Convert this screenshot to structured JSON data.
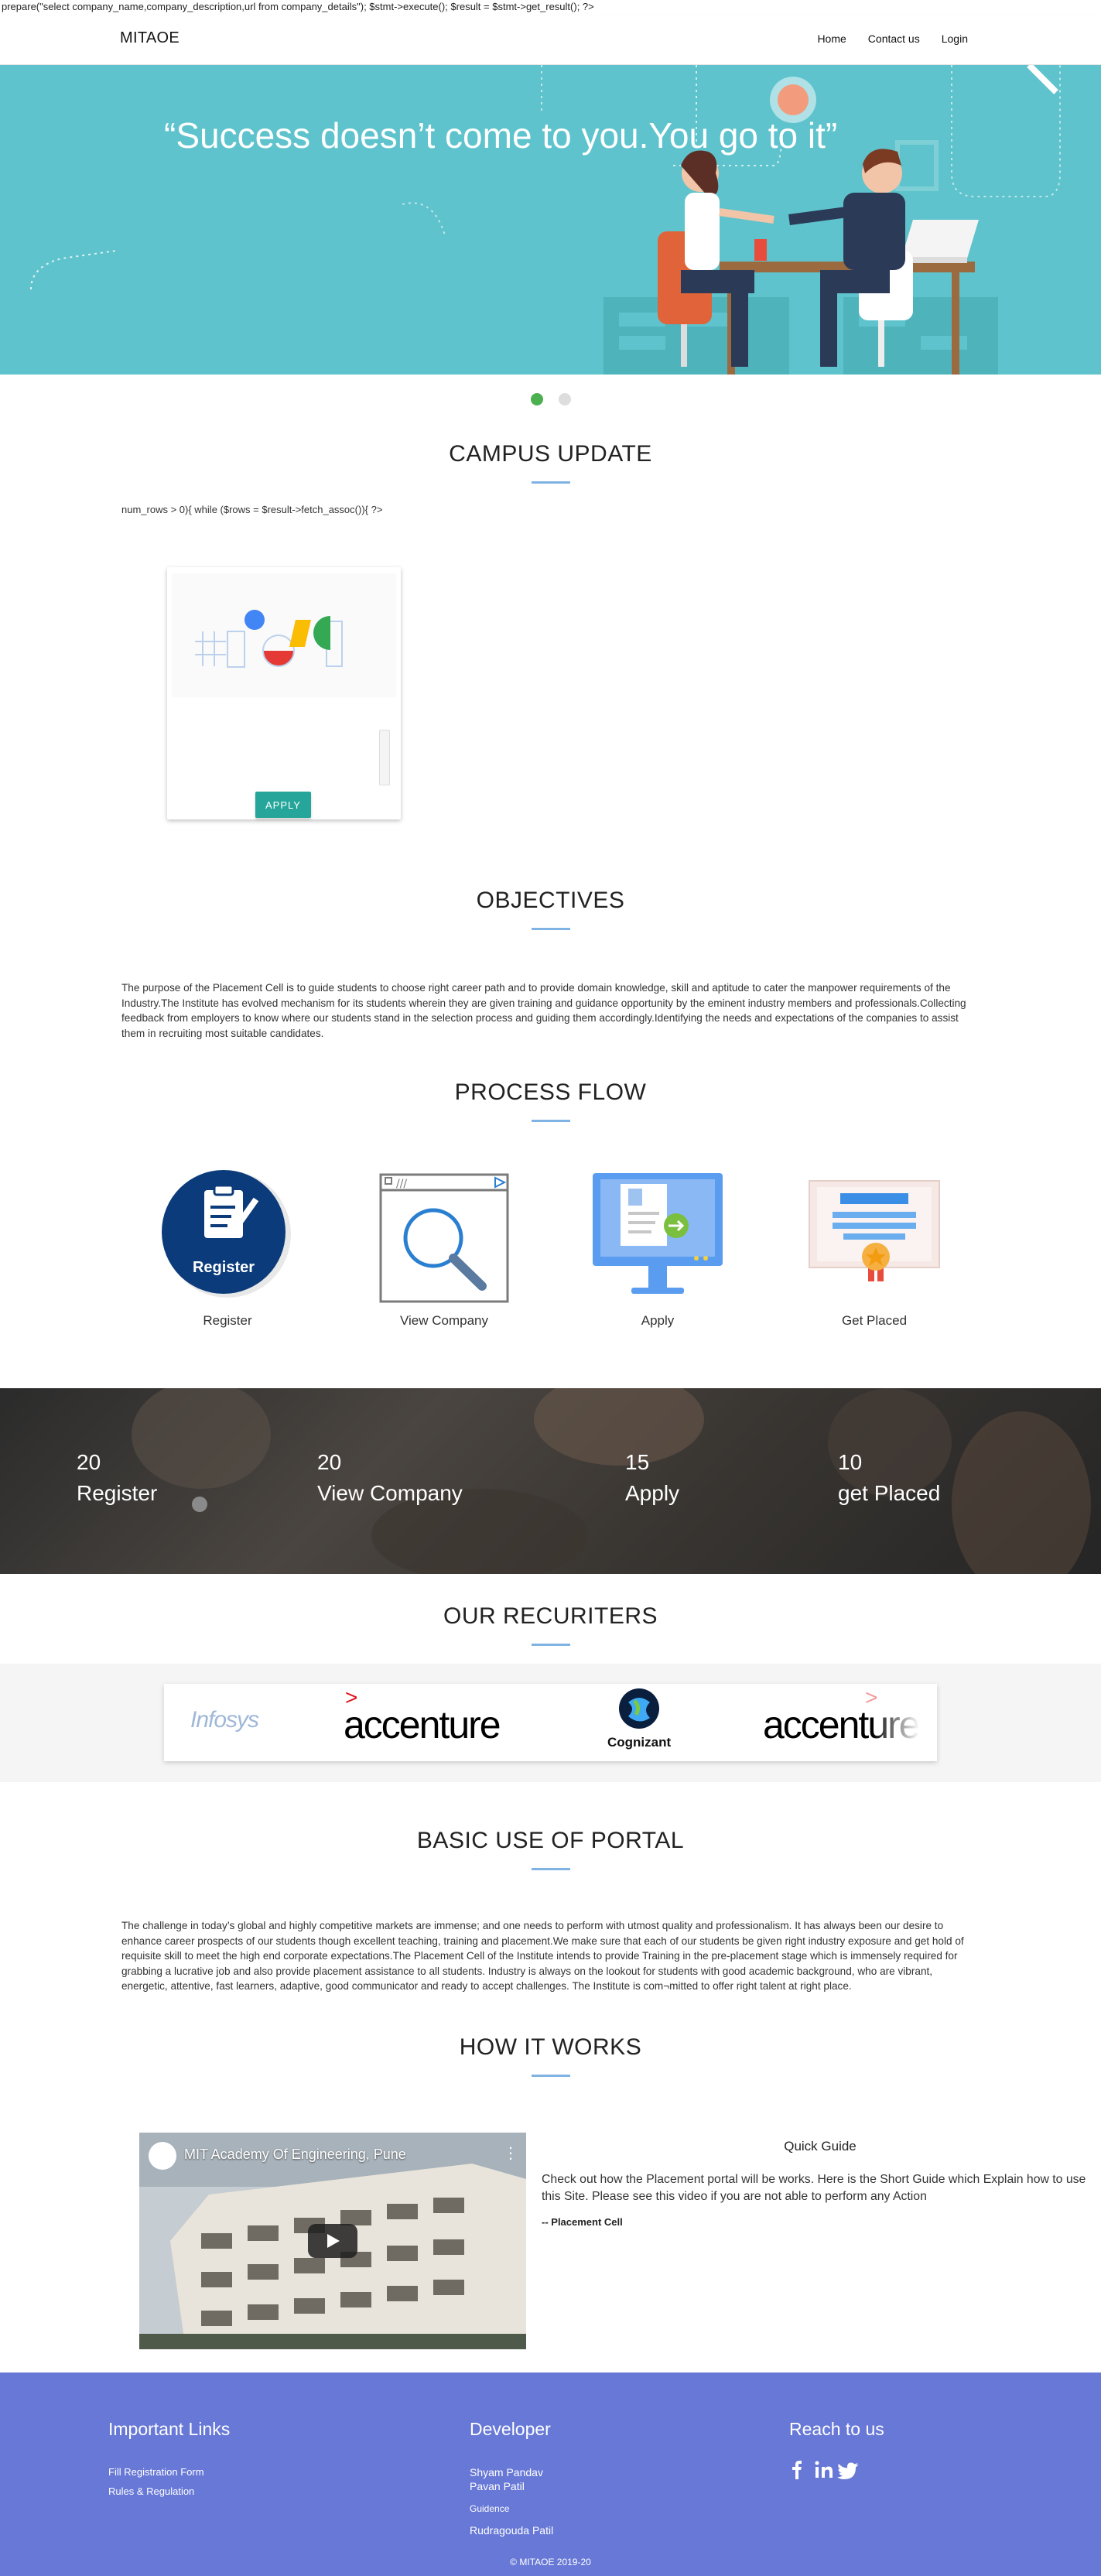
{
  "debug": {
    "php_top": "prepare(\"select company_name,company_description,url from company_details\"); $stmt->execute(); $result = $stmt->get_result(); ?>",
    "php_loop": "num_rows > 0){ while ($rows = $result->fetch_assoc()){ ?>"
  },
  "nav": {
    "brand": "MITAOE",
    "links": [
      "Home",
      "Contact us",
      "Login"
    ]
  },
  "hero": {
    "quote": "“Success doesn’t come to you.You go to it”"
  },
  "sections": {
    "campus_update": "CAMPUS UPDATE",
    "objectives": "OBJECTIVES",
    "process_flow": "PROCESS FLOW",
    "recruiters": "OUR RECURITERS",
    "basic_use": "BASIC USE OF PORTAL",
    "how_it_works": "HOW IT WORKS"
  },
  "campus_card": {
    "apply_label": "APPLY"
  },
  "objectives_text": "The purpose of the Placement Cell is to guide students to choose right career path and to provide domain knowledge, skill and aptitude to cater the manpower requirements of the Industry.The Institute has evolved mechanism for its students wherein they are given training and guidance opportunity by the eminent industry members and professionals.Collecting feedback from employers to know where our students stand in the selection process and guiding them accordingly.Identifying the needs and expectations of the companies to assist them in recruiting most suitable candidates.",
  "process": [
    {
      "label": "Register",
      "icon": "register-badge-icon",
      "icon_text": "Register"
    },
    {
      "label": "View Company",
      "icon": "browser-search-icon"
    },
    {
      "label": "Apply",
      "icon": "monitor-apply-icon"
    },
    {
      "label": "Get Placed",
      "icon": "certificate-icon"
    }
  ],
  "counters": [
    {
      "num": "20",
      "label": "Register"
    },
    {
      "num": "20",
      "label": "View Company"
    },
    {
      "num": "15",
      "label": "Apply"
    },
    {
      "num": "10",
      "label": "get Placed"
    }
  ],
  "recruiters": [
    "Infosys",
    "accenture",
    "Cognizant",
    "accenture"
  ],
  "basic_use_text": "The challenge in today’s global and highly competitive markets are immense; and one needs to perform with utmost quality and professionalism. It has always been our desire to enhance career prospects of our students though excellent teaching, training and placement.We make sure that each of our students be given right industry exposure and get hold of requisite skill to meet the high end corporate expectations.The Placement Cell of the Institute intends to provide Training in the pre-placement stage which is immensely required for grabbing a lucrative job and also provide placement assistance to all students. Industry is always on the lookout for students with good academic background, who are vibrant, energetic, attentive, fast learners, adaptive, good communicator and ready to accept challenges. The Institute is com¬mitted to offer right talent at right place.",
  "video": {
    "title": "MIT Academy Of Engineering, Pune"
  },
  "guide": {
    "title": "Quick Guide",
    "text": "Check out how the Placement portal will be works. Here is the Short Guide which Explain how to use this Site. Please see this video if you are not able to perform any Action",
    "signature": "-- Placement Cell"
  },
  "footer": {
    "links_title": "Important Links",
    "links": [
      "Fill Registration Form",
      "Rules & Regulation"
    ],
    "dev_title": "Developer",
    "devs": [
      "Shyam Pandav",
      "Pavan Patil",
      "Guidence",
      "Rudragouda Patil"
    ],
    "reach_title": "Reach to us",
    "social": [
      "facebook-icon",
      "linkedin-icon",
      "twitter-icon"
    ],
    "copyright": "© MITAOE 2019-20"
  },
  "colors": {
    "hero_bg": "#5ec3cc",
    "accent_line": "#7fb3e3",
    "apply_button": "#26a69a",
    "footer_bg": "#6878d6",
    "active_dot": "#4caf50"
  }
}
